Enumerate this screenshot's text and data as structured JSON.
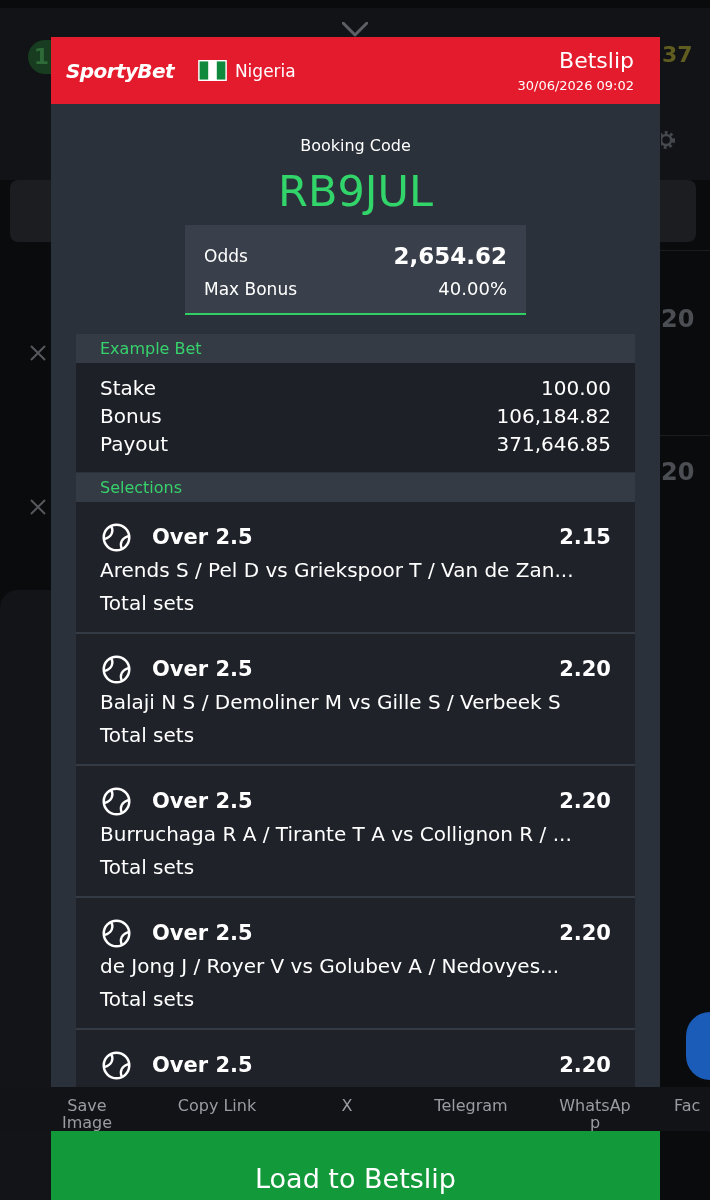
{
  "background": {
    "badge": "1",
    "score": "37",
    "rows": [
      {
        "odds": "20"
      },
      {
        "odds": "20"
      }
    ]
  },
  "dialog": {
    "brand": "SportyBet",
    "country": "Nigeria",
    "title": "Betslip",
    "datetime": "30/06/2026 09:02"
  },
  "booking": {
    "label": "Booking Code",
    "code": "RB9JUL"
  },
  "summary": {
    "odds_label": "Odds",
    "odds": "2,654.62",
    "bonus_label": "Max Bonus",
    "bonus": "40.00%"
  },
  "example_bet": {
    "title": "Example Bet",
    "rows": [
      {
        "label": "Stake",
        "value": "100.00"
      },
      {
        "label": "Bonus",
        "value": "106,184.82"
      },
      {
        "label": "Payout",
        "value": "371,646.85"
      }
    ]
  },
  "selections": {
    "title": "Selections",
    "items": [
      {
        "market": "Over 2.5",
        "odds": "2.15",
        "match": "Arends S / Pel D vs Griekspoor T / Van de Zan...",
        "bet_type": "Total sets"
      },
      {
        "market": "Over 2.5",
        "odds": "2.20",
        "match": "Balaji N S / Demoliner M vs Gille S / Verbeek S",
        "bet_type": "Total sets"
      },
      {
        "market": "Over 2.5",
        "odds": "2.20",
        "match": "Burruchaga R A / Tirante T A vs Collignon R / ...",
        "bet_type": "Total sets"
      },
      {
        "market": "Over 2.5",
        "odds": "2.20",
        "match": "de Jong J / Royer V vs Golubev A / Nedovyes...",
        "bet_type": "Total sets"
      },
      {
        "market": "Over 2.5",
        "odds": "2.20"
      }
    ]
  },
  "share_options": [
    "Save Image",
    "Copy Link",
    "X",
    "Telegram",
    "WhatsApp",
    "Fac"
  ],
  "primary_button": "Load to Betslip"
}
